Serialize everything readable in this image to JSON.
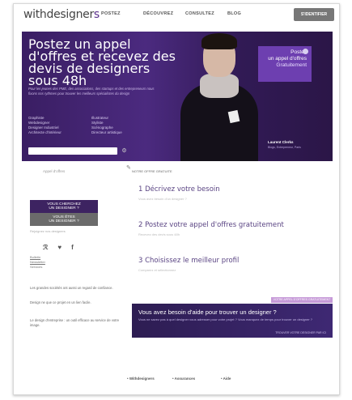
{
  "header": {
    "logo_main": "withdesigner",
    "logo_mark": "s",
    "nav": [
      "POSTEZ",
      "DÉCOUVREZ",
      "CONSULTEZ",
      "BLOG"
    ],
    "login_label": "S'IDENTIFIER"
  },
  "hero": {
    "title": "Postez un appel d'offres et recevez des devis de designers sous 48h",
    "description": "Pour les jeunes des PME, des associations, des startups et des entrepreneurs nous fixons nos rythmes pour trouver les meilleurs spécialistes du design",
    "categories_left": [
      "Graphiste",
      "Webdesigner",
      "Designer Industriel",
      "Architecte d'intérieur"
    ],
    "categories_right": [
      "Illustrateur",
      "Styliste",
      "Scénographe",
      "Directeur artistique"
    ],
    "cta_lines": [
      "Postez",
      "un appel d'offres",
      "Gratuitement"
    ],
    "quote_name": "Laurent Clerks",
    "quote_role": "Blogs, Entrepreneur, Paris"
  },
  "left": {
    "search_label": "Appel d'offres",
    "designer_box": [
      "VOUS CHERCHEZ",
      "UN DESIGNER ?"
    ],
    "artist_box": [
      "VOUS ÊTES",
      "UN DESIGNER ?"
    ],
    "caption": "Rejoignez nos designers",
    "social": [
      "rss",
      "twitter",
      "facebook"
    ],
    "link_lines": [
      "Bulletin",
      "Newsletter",
      "Services"
    ],
    "text1": "Les grandes sociétés ont aussi un regard de confiance.",
    "text2": "Design ne que ce projet en un lien facile.",
    "text3": "Le design d'entreprise : un outil efficace au service de votre image."
  },
  "steps": {
    "header": "NOTRE OFFRE GRATUITE",
    "items": [
      {
        "label": "1  Décrivez votre besoin",
        "sub": "Vous avez besoin d'un designer ?"
      },
      {
        "label": "2  Postez votre appel d'offres gratuitement",
        "sub": "Recevez des devis sous 48h"
      },
      {
        "label": "3  Choisissez le meilleur profil",
        "sub": "Comparez et sélectionnez"
      }
    ]
  },
  "banner": {
    "tag": "VOTRE APPEL D'OFFRES GRATUITEMENT",
    "title": "Vous avez besoin d'aide pour trouver un designer ?",
    "sub": "Vous ne savez pas à quel designer vous adresser pour votre projet ? Vous manquez de temps pour trouver un designer ?",
    "link": "TROUVER VOTRE DESIGNER PAR ICI"
  },
  "footer": {
    "links": [
      "Withdesigners",
      "Assurances",
      "Aide"
    ]
  }
}
